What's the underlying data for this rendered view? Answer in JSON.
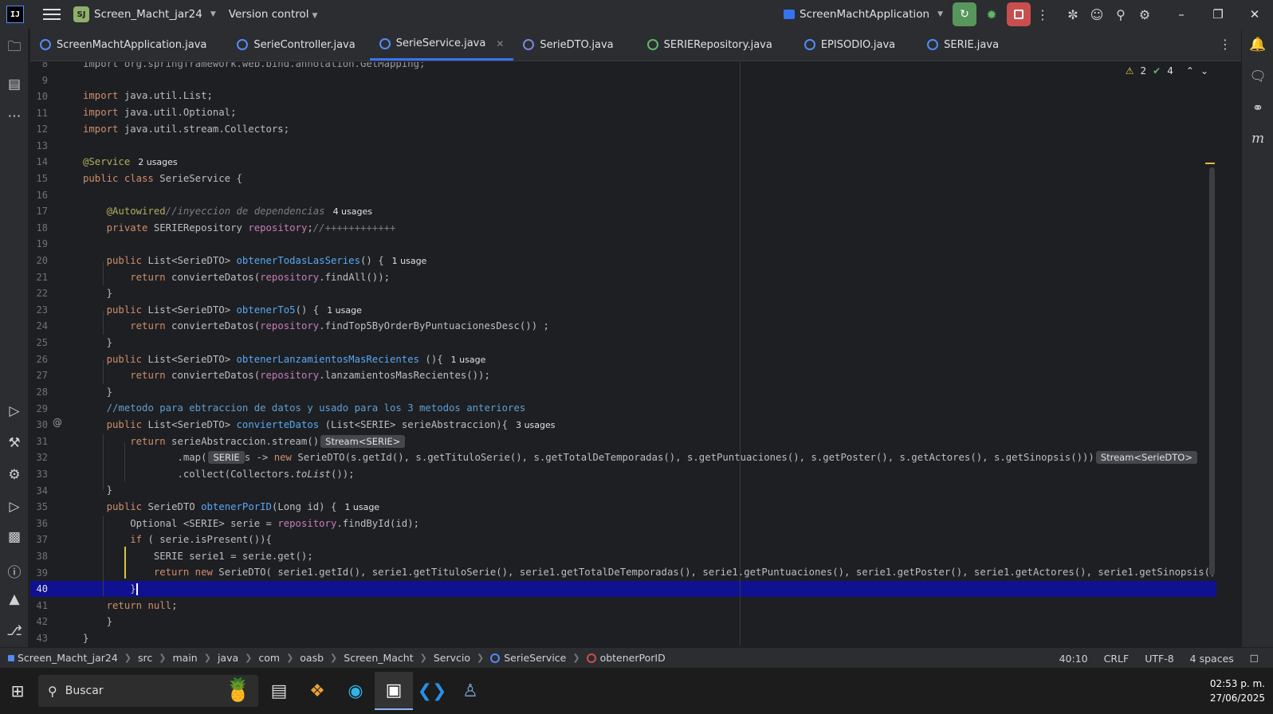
{
  "titlebar": {
    "logo": "IJ",
    "project_badge": "SJ",
    "project_name": "Screen_Macht_jar24",
    "version_control": "Version control",
    "run_config": "ScreenMachtApplication"
  },
  "tabs": [
    {
      "label": "ScreenMachtApplication.java",
      "icon": "class-icon"
    },
    {
      "label": "SerieController.java",
      "icon": "class-icon"
    },
    {
      "label": "SerieService.java",
      "icon": "class-icon",
      "active": true
    },
    {
      "label": "SerieDTO.java",
      "icon": "record-icon"
    },
    {
      "label": "SERIERepository.java",
      "icon": "interface-icon"
    },
    {
      "label": "EPISODIO.java",
      "icon": "class-icon"
    },
    {
      "label": "SERIE.java",
      "icon": "class-icon"
    }
  ],
  "inspections": {
    "warnings": "2",
    "ok": "4"
  },
  "editor": {
    "line_numbers": [
      "8",
      "9",
      "10",
      "11",
      "12",
      "13",
      "14",
      "15",
      "16",
      "17",
      "18",
      "19",
      "20",
      "21",
      "22",
      "23",
      "24",
      "25",
      "26",
      "27",
      "28",
      "29",
      "30",
      "31",
      "32",
      "33",
      "34",
      "35",
      "36",
      "37",
      "38",
      "39",
      "40",
      "41",
      "42",
      "43"
    ],
    "usages": {
      "service": "2 usages",
      "autowired": "4 usages",
      "l20": "1 usage",
      "l23": "1 usage",
      "l26": "1 usage",
      "l30": "3 usages",
      "l35": "1 usage"
    },
    "hints": {
      "stream_serie": "Stream<SERIE>",
      "serie": "SERIE",
      "stream_dto": "Stream<SerieDTO>"
    }
  },
  "statusbar": {
    "breadcrumb": [
      "Screen_Macht_jar24",
      "src",
      "main",
      "java",
      "com",
      "oasb",
      "Screen_Macht",
      "Servcio",
      "SerieService",
      "obtenerPorID"
    ],
    "position": "40:10",
    "line_sep": "CRLF",
    "encoding": "UTF-8",
    "indent": "4 spaces"
  },
  "taskbar": {
    "search_placeholder": "Buscar",
    "time": "02:53 p. m.",
    "date": "27/06/2025"
  }
}
